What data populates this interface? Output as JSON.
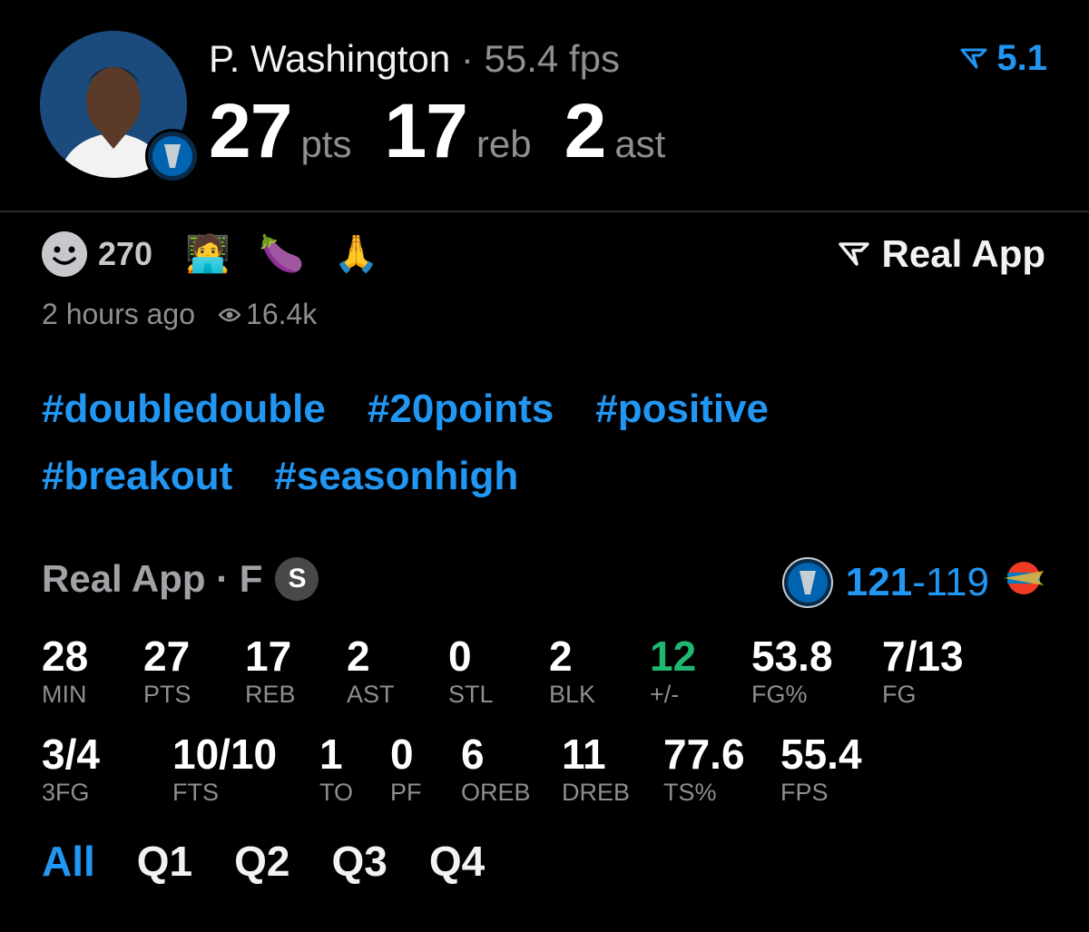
{
  "player": {
    "name": "P. Washington",
    "fps_label": "55.4 fps",
    "pts": "27",
    "pts_unit": "pts",
    "reb": "17",
    "reb_unit": "reb",
    "ast": "2",
    "ast_unit": "ast"
  },
  "header_score": "5.1",
  "reactions": {
    "count": "270",
    "emojis": [
      "🧑‍💻",
      "🍆",
      "🙏"
    ]
  },
  "brand": "Real App",
  "meta": {
    "time": "2 hours ago",
    "views": "16.4k"
  },
  "hashtags": [
    "#doubledouble",
    "#20points",
    "#positive",
    "#breakout",
    "#seasonhigh"
  ],
  "box": {
    "source": "Real App · F",
    "badge": "S",
    "score_home": "121",
    "score_dash": "-",
    "score_away": "119"
  },
  "stats_row1": [
    {
      "value": "28",
      "label": "MIN"
    },
    {
      "value": "27",
      "label": "PTS"
    },
    {
      "value": "17",
      "label": "REB"
    },
    {
      "value": "2",
      "label": "AST"
    },
    {
      "value": "0",
      "label": "STL"
    },
    {
      "value": "2",
      "label": "BLK"
    },
    {
      "value": "12",
      "label": "+/-"
    },
    {
      "value": "53.8",
      "label": "FG%"
    },
    {
      "value": "7/13",
      "label": "FG"
    }
  ],
  "stats_row2": [
    {
      "value": "3/4",
      "label": "3FG"
    },
    {
      "value": "10/10",
      "label": "FTS"
    },
    {
      "value": "1",
      "label": "TO"
    },
    {
      "value": "0",
      "label": "PF"
    },
    {
      "value": "6",
      "label": "OREB"
    },
    {
      "value": "11",
      "label": "DREB"
    },
    {
      "value": "77.6",
      "label": "TS%"
    },
    {
      "value": "55.4",
      "label": "FPS"
    }
  ],
  "tabs": [
    "All",
    "Q1",
    "Q2",
    "Q3",
    "Q4"
  ],
  "colors": {
    "accent": "#2196f3",
    "positive": "#1fb871",
    "background": "#000000"
  },
  "icons": [
    "player-photo",
    "mavericks-logo",
    "real-app-logo-icon",
    "smiley-icon",
    "eye-icon",
    "thunder-logo"
  ]
}
